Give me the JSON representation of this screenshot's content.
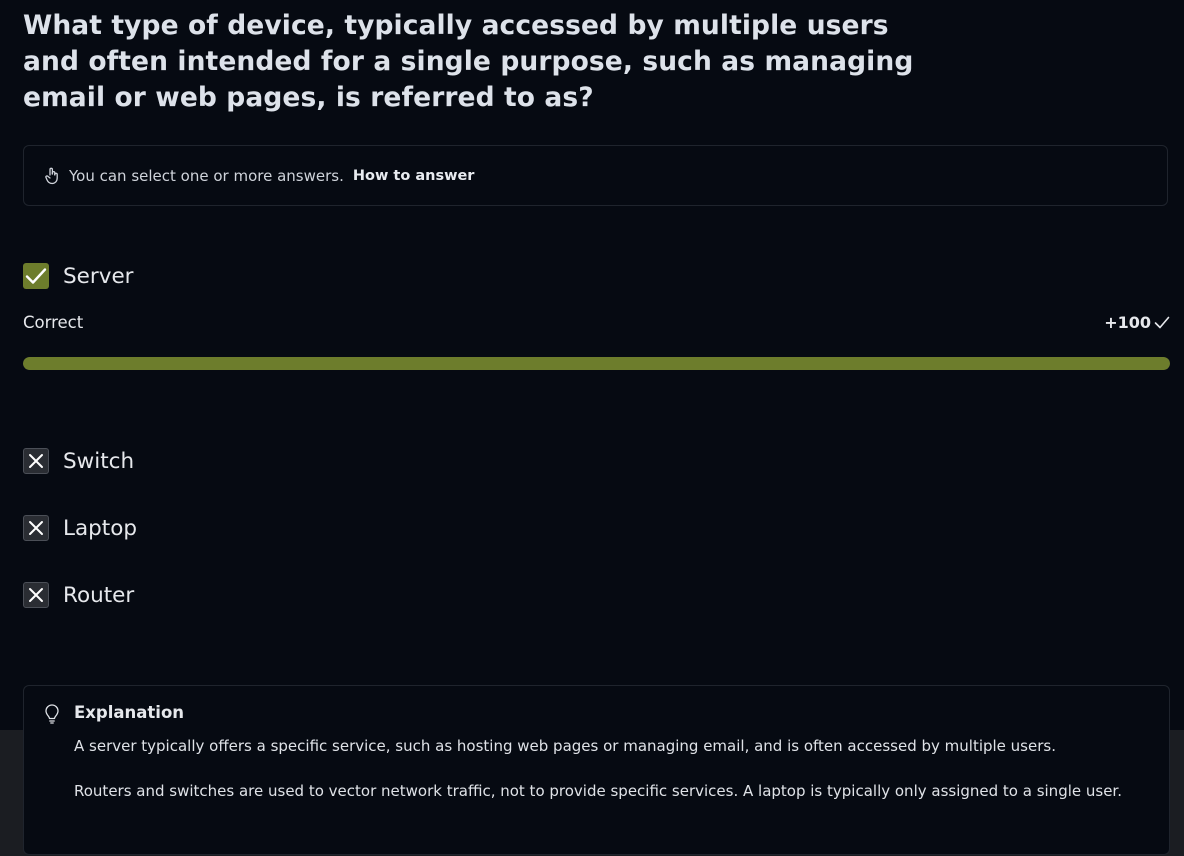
{
  "question": "What type of device, typically accessed by multiple users and often intended for a single purpose, such as managing email or web pages, is referred to as?",
  "hint": {
    "text": "You can select one or more answers.",
    "link": "How to answer"
  },
  "options": [
    {
      "label": "Server",
      "state": "checked"
    },
    {
      "label": "Switch",
      "state": "crossed"
    },
    {
      "label": "Laptop",
      "state": "crossed"
    },
    {
      "label": "Router",
      "state": "crossed"
    }
  ],
  "result": {
    "label": "Correct",
    "score": "+100",
    "progress_percent": 100
  },
  "explanation": {
    "title": "Explanation",
    "paragraphs": [
      "A server typically offers a specific service, such as hosting web pages or managing email, and is often accessed by multiple users.",
      "Routers and switches are used to vector network traffic, not to provide specific services. A laptop is typically only assigned to a single user."
    ]
  },
  "colors": {
    "background": "#060a12",
    "correct_accent": "#6d7d2c",
    "crossed_box": "#2a2d33"
  },
  "icons": {
    "hint": "pointing-hand-icon",
    "checked": "checkmark-icon",
    "crossed": "x-icon",
    "score": "checkmark-icon",
    "explanation": "lightbulb-icon"
  }
}
